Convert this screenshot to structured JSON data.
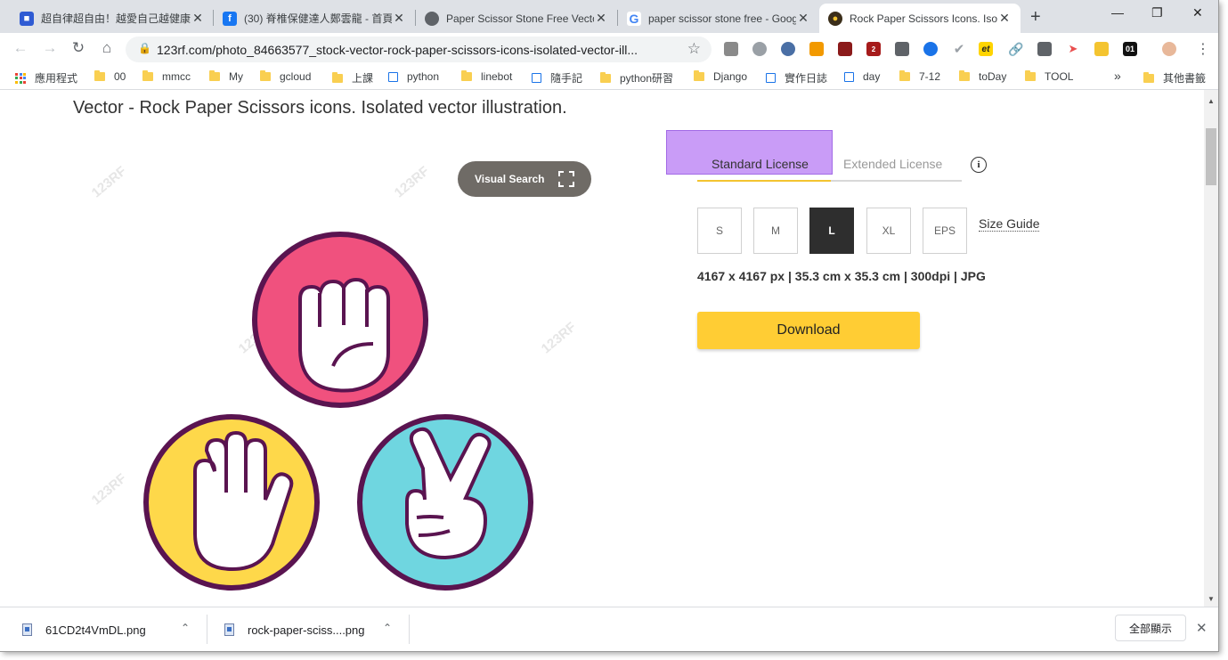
{
  "tabs": [
    {
      "title": "超自律超自由！越愛自己越健康"
    },
    {
      "title": "(30) 脊椎保健達人鄭雲龍 - 首頁"
    },
    {
      "title": "Paper Scissor Stone Free Vector"
    },
    {
      "title": "paper scissor stone free - Google"
    },
    {
      "title": "Rock Paper Scissors Icons. Isolated"
    }
  ],
  "toolbar": {
    "url": "123rf.com/photo_84663577_stock-vector-rock-paper-scissors-icons-isolated-vector-ill...",
    "ext_badge": "2",
    "ext_et": "et",
    "ext_01": "01"
  },
  "bookmarks": [
    {
      "label": "應用程式",
      "kind": "apps"
    },
    {
      "label": "00",
      "kind": "folder"
    },
    {
      "label": "mmcc",
      "kind": "folder"
    },
    {
      "label": "My",
      "kind": "folder"
    },
    {
      "label": "gcloud",
      "kind": "folder"
    },
    {
      "label": "上課",
      "kind": "folder"
    },
    {
      "label": "python",
      "kind": "page"
    },
    {
      "label": "linebot",
      "kind": "folder"
    },
    {
      "label": "隨手記",
      "kind": "page"
    },
    {
      "label": "python研習",
      "kind": "folder"
    },
    {
      "label": "Django",
      "kind": "folder"
    },
    {
      "label": "實作日誌",
      "kind": "page"
    },
    {
      "label": "day",
      "kind": "page"
    },
    {
      "label": "7-12",
      "kind": "folder"
    },
    {
      "label": "toDay",
      "kind": "folder"
    },
    {
      "label": "TOOL",
      "kind": "folder"
    },
    {
      "label": "其他書籤",
      "kind": "folder"
    }
  ],
  "page": {
    "headline": "Vector - Rock Paper Scissors icons. Isolated vector illustration.",
    "visual_search": "Visual Search",
    "watermark": "123RF",
    "license_tabs": {
      "standard": "Standard License",
      "extended": "Extended License"
    },
    "info_glyph": "i",
    "sizes": [
      {
        "label": "S",
        "selected": false
      },
      {
        "label": "M",
        "selected": false
      },
      {
        "label": "L",
        "selected": true
      },
      {
        "label": "XL",
        "selected": false
      },
      {
        "label": "EPS",
        "selected": false
      }
    ],
    "size_guide": "Size Guide",
    "dimensions": "4167 x 4167 px | 35.3 cm x 35.3 cm | 300dpi | JPG",
    "download": "Download"
  },
  "illustration": {
    "rock": {
      "fill": "#f0517e"
    },
    "paper": {
      "fill": "#fed84a"
    },
    "scissors": {
      "fill": "#6fd6e0"
    },
    "outline": "#5a1450"
  },
  "downloads": [
    {
      "name": "61CD2t4VmDL.png"
    },
    {
      "name": "rock-paper-sciss....png"
    }
  ],
  "show_all": "全部顯示",
  "colors": {
    "download_button": "#ffcd34",
    "license_highlight": "#c99cf7",
    "selected_size": "#2e2e2e"
  }
}
